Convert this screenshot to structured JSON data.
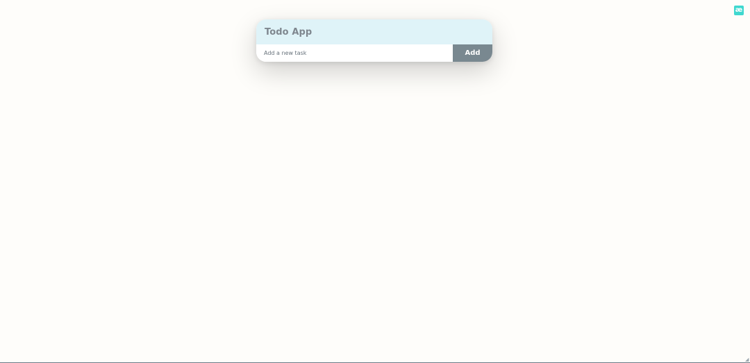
{
  "app": {
    "title": "Todo App"
  },
  "new_task": {
    "value": "",
    "placeholder": "Add a new task"
  },
  "actions": {
    "add_label": "Add"
  },
  "corner_badge": {
    "label": "æ",
    "color": "#3fd8cf",
    "icon": "ae-extension-icon"
  },
  "resize_grip": {
    "icon": "resize-grip-icon",
    "glyph": "◢"
  },
  "theme": {
    "header_background": "#dff3f8",
    "button_background": "#798890",
    "page_background": "#fefdfa"
  }
}
